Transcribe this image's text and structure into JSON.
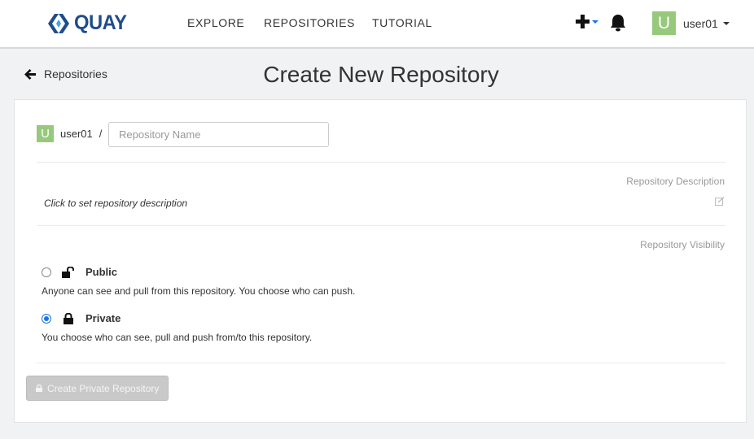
{
  "navbar": {
    "logo_text": "QUAY",
    "links": [
      "EXPLORE",
      "REPOSITORIES",
      "TUTORIAL"
    ],
    "plus_icon": "plus-icon",
    "bell_icon": "bell-icon",
    "avatar_letter": "U",
    "username": "user01"
  },
  "header": {
    "back_label": "Repositories",
    "title": "Create New Repository"
  },
  "form": {
    "namespace_avatar": "U",
    "namespace": "user01",
    "separator": "/",
    "repo_name_value": "",
    "repo_name_placeholder": "Repository Name",
    "description_label": "Repository Description",
    "description_placeholder": "Click to set repository description",
    "visibility_label": "Repository Visibility",
    "visibility": [
      {
        "label": "Public",
        "description": "Anyone can see and pull from this repository. You choose who can push.",
        "checked": false,
        "icon": "unlock-icon"
      },
      {
        "label": "Private",
        "description": "You choose who can see, pull and push from/to this repository.",
        "checked": true,
        "icon": "lock-icon"
      }
    ],
    "submit_label": "Create Private Repository"
  },
  "colors": {
    "brand": "#1f4d8c",
    "avatar": "#97c97d",
    "radio_selected": "#1a73e8",
    "button_disabled": "#c9c9c9"
  }
}
